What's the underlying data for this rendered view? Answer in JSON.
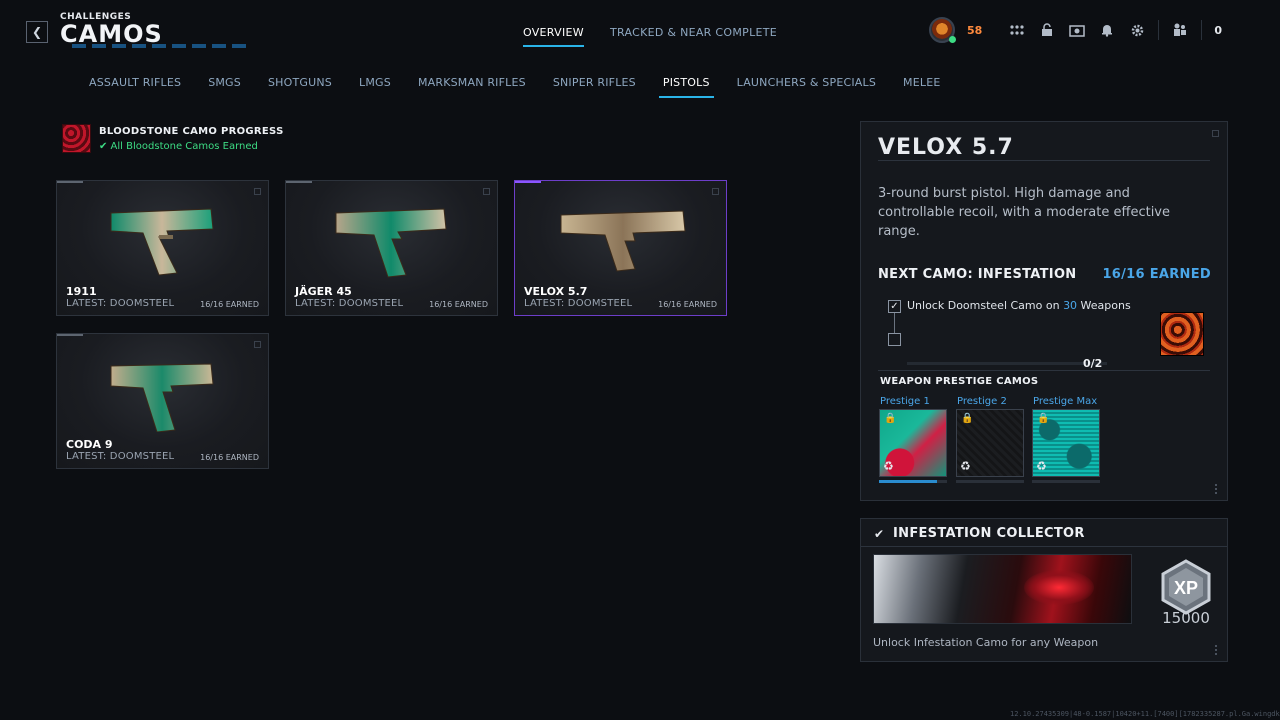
{
  "header": {
    "breadcrumb": "CHALLENGES",
    "title": "CAMOS",
    "tabs": [
      {
        "label": "OVERVIEW",
        "active": true
      },
      {
        "label": "TRACKED & NEAR COMPLETE",
        "active": false
      }
    ],
    "level": "58",
    "count": "0"
  },
  "categories": [
    {
      "label": "ASSAULT RIFLES",
      "active": false
    },
    {
      "label": "SMGS",
      "active": false
    },
    {
      "label": "SHOTGUNS",
      "active": false
    },
    {
      "label": "LMGS",
      "active": false
    },
    {
      "label": "MARKSMAN RIFLES",
      "active": false
    },
    {
      "label": "SNIPER RIFLES",
      "active": false
    },
    {
      "label": "PISTOLS",
      "active": true
    },
    {
      "label": "LAUNCHERS & SPECIALS",
      "active": false
    },
    {
      "label": "MELEE",
      "active": false
    }
  ],
  "bloodstone": {
    "title": "BLOODSTONE CAMO PROGRESS",
    "status": "✔ All Bloodstone Camos Earned"
  },
  "weapons": [
    {
      "name": "1911",
      "latest": "LATEST: DOOMSTEEL",
      "earned": "16/16 EARNED",
      "selected": false
    },
    {
      "name": "JÄGER 45",
      "latest": "LATEST: DOOMSTEEL",
      "earned": "16/16 EARNED",
      "selected": false
    },
    {
      "name": "VELOX 5.7",
      "latest": "LATEST: DOOMSTEEL",
      "earned": "16/16 EARNED",
      "selected": true
    },
    {
      "name": "CODA 9",
      "latest": "LATEST: DOOMSTEEL",
      "earned": "16/16 EARNED",
      "selected": false
    }
  ],
  "detail": {
    "title": "VELOX 5.7",
    "description": "3-round burst pistol. High damage and controllable recoil, with a moderate effective range.",
    "next_camo_label": "NEXT CAMO: INFESTATION",
    "next_camo_earned": "16/16 EARNED",
    "task_prefix": "Unlock Doomsteel Camo on ",
    "task_number": "30",
    "task_suffix": " Weapons",
    "task_progress": "0/2",
    "prestige_title": "WEAPON PRESTIGE CAMOS",
    "prestige": [
      {
        "label": "Prestige 1",
        "progress": 0.85
      },
      {
        "label": "Prestige 2",
        "progress": 0
      },
      {
        "label": "Prestige Max",
        "progress": 0
      }
    ]
  },
  "collector": {
    "title": "INFESTATION COLLECTOR",
    "xp_label": "XP",
    "xp_amount": "15000",
    "description": "Unlock Infestation Camo for any Weapon"
  },
  "footer_id": "12.10.27435309|48-0.1587|10420+11.[7400][1782335287.pl.Ga.wingdk|]0001221800"
}
